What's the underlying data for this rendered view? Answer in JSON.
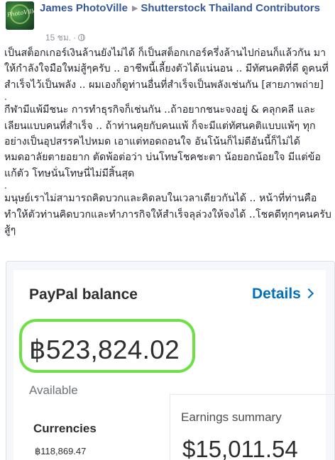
{
  "post": {
    "author": "James PhotoVille",
    "group": "Shutterstock Thailand Contributors",
    "time": "15 ชม.",
    "avatar_logo_text": "PhotoVille",
    "paragraphs": [
      "เป็นสต็อกเกอร์เงินล้านยังไม่ได้ ก็เป็นสต็อกเกอร์ครึ่งล้านไปก่อนก็แล้วกัน มาให้กำลังใจมือใหม่สู้ๆครับ .. อาชีพนี้เลี้ยงตัวได้แน่นอน .. มีทัศนคติที่ดี ดูคนที่สำเร็จไว้เป็นพลัง .. ผมเองก็ดูท่านอื่นที่สำเร็จเป็นพลังเช่นกัน [สายภาพถ่าย]",
      "กีฬามีแพ้มีชนะ การทำธุรกิจก็เช่นกัน ..ถ้าอยากชนะจงอยู่ & คลุกคลี และเลียนแบบคนที่สำเร็จ .. ถ้าท่านคุยกับคนแพ้ ก็จะมีแต่ทัศนคติแบบแพ้ๆ ทุกอย่างเป็นอุปสรรคไปหมด เอาแต่ทอดถอนใจ อันโน้นก็ไม่ดีอันนี้ก็ไม่ได้ หมดอาลัยตายอยาก ตัดพ้อต่อว่า บ่นโทษโชคชะตา น้อยอกน้อยใจ มีแต่ข้อแก้ตัว โทษนั่นโทษนี่ไม่มีสิ้นสุด",
      "มนุษย์เราไม่สามารถคิดบวกและคิดลบในเวลาเดียวกันได้ .. หน้าที่ท่านคือทำให้ตัวท่านคิดบวกและทำภารกิจให้สำเร็จลุล่วงให้จงได้ ..โชคดีทุกๆคนครับสู้ๆ"
    ],
    "separator": "."
  },
  "paypal": {
    "title": "PayPal balance",
    "details_label": "Details",
    "balance": "฿523,824.02",
    "available_label": "Available",
    "currencies_label": "Currencies",
    "currency_value": "฿118,869.47",
    "earnings_title": "Earnings summary",
    "earnings_value": "$15,011.54",
    "highlight_color": "#6ee046",
    "link_color": "#0070ba"
  },
  "colors": {
    "author_link": "#365899",
    "meta_gray": "#90949c"
  },
  "icons": {
    "breadcrumb": "triangle-right-icon",
    "privacy": "globe-icon",
    "details": "chevron-right-icon"
  }
}
